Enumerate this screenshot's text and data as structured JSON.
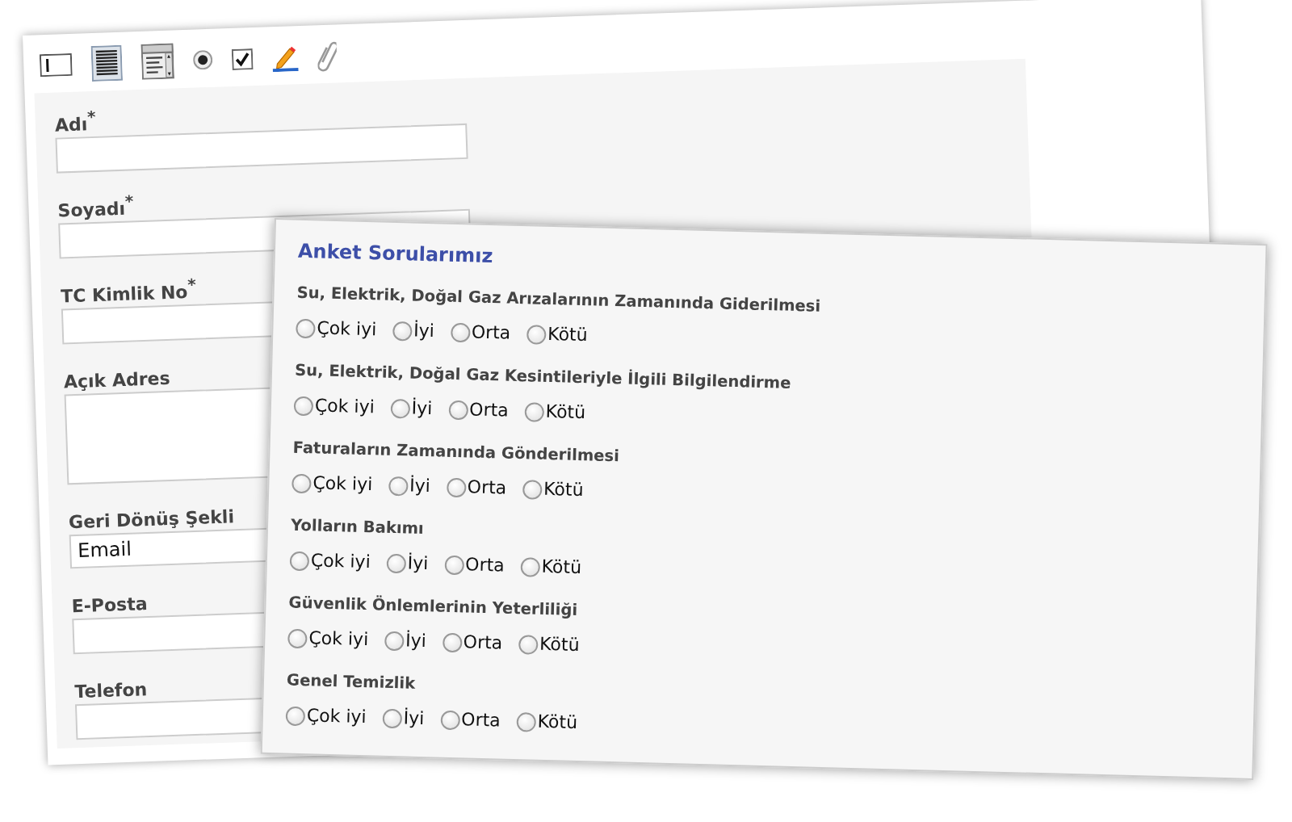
{
  "form": {
    "fields": [
      {
        "kind": "text",
        "label": "Adı",
        "mark": "*"
      },
      {
        "kind": "text",
        "label": "Soyadı",
        "mark": "*"
      },
      {
        "kind": "text",
        "label": "TC Kimlik No",
        "mark": "*"
      },
      {
        "kind": "textarea",
        "label": "Açık Adres"
      },
      {
        "kind": "select",
        "label": "Geri Dönüş Şekli",
        "value": "Email"
      },
      {
        "kind": "text",
        "label": "E-Posta"
      },
      {
        "kind": "text",
        "label": "Telefon"
      }
    ]
  },
  "survey": {
    "title": "Anket Sorularımız",
    "questions": [
      {
        "text": "Su, Elektrik, Doğal Gaz Arızalarının Zamanında Giderilmesi",
        "options": [
          {
            "label": "Çok iyi",
            "selected": false
          },
          {
            "label": "İyi",
            "selected": false
          },
          {
            "label": "Orta",
            "selected": false
          },
          {
            "label": "Kötü",
            "selected": false
          }
        ]
      },
      {
        "text": "Su, Elektrik, Doğal Gaz Kesintileriyle İlgili Bilgilendirme",
        "options": [
          {
            "label": "Çok iyi",
            "selected": false
          },
          {
            "label": "İyi",
            "selected": false
          },
          {
            "label": "Orta",
            "selected": false
          },
          {
            "label": "Kötü",
            "selected": false
          }
        ]
      },
      {
        "text": "Faturaların Zamanında Gönderilmesi",
        "options": [
          {
            "label": "Çok iyi",
            "selected": false
          },
          {
            "label": "İyi",
            "selected": false
          },
          {
            "label": "Orta",
            "selected": false
          },
          {
            "label": "Kötü",
            "selected": false
          }
        ]
      },
      {
        "text": "Yolların Bakımı",
        "options": [
          {
            "label": "Çok iyi",
            "selected": false
          },
          {
            "label": "İyi",
            "selected": false
          },
          {
            "label": "Orta",
            "selected": false
          },
          {
            "label": "Kötü",
            "selected": false
          }
        ]
      },
      {
        "text": "Güvenlik Önlemlerinin Yeterliliği",
        "options": [
          {
            "label": "Çok iyi",
            "selected": false
          },
          {
            "label": "İyi",
            "selected": false
          },
          {
            "label": "Orta",
            "selected": false
          },
          {
            "label": "Kötü",
            "selected": false
          }
        ]
      },
      {
        "text": "Genel Temizlik",
        "options": [
          {
            "label": "Çok iyi",
            "selected": false
          },
          {
            "label": "İyi",
            "selected": false
          },
          {
            "label": "Orta",
            "selected": false
          },
          {
            "label": "Kötü",
            "selected": false
          }
        ]
      }
    ]
  }
}
